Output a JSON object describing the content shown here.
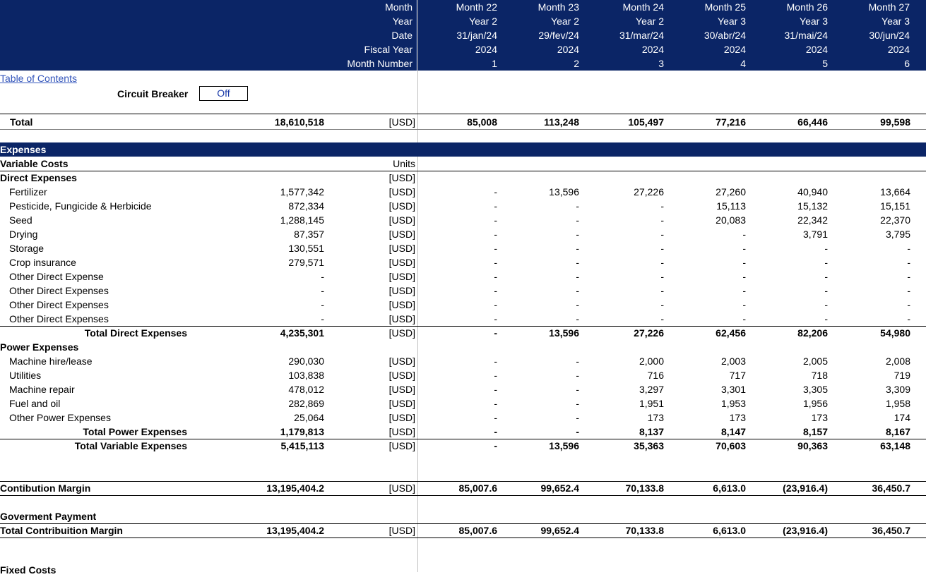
{
  "header": {
    "labels": [
      "Month",
      "Year",
      "Date",
      "Fiscal Year",
      "Month Number"
    ],
    "months": [
      {
        "month": "Month 22",
        "year": "Year 2",
        "date": "31/jan/24",
        "fiscal": "2024",
        "num": "1"
      },
      {
        "month": "Month 23",
        "year": "Year 2",
        "date": "29/fev/24",
        "fiscal": "2024",
        "num": "2"
      },
      {
        "month": "Month 24",
        "year": "Year 2",
        "date": "31/mar/24",
        "fiscal": "2024",
        "num": "3"
      },
      {
        "month": "Month 25",
        "year": "Year 3",
        "date": "30/abr/24",
        "fiscal": "2024",
        "num": "4"
      },
      {
        "month": "Month 26",
        "year": "Year 3",
        "date": "31/mai/24",
        "fiscal": "2024",
        "num": "5"
      },
      {
        "month": "Month 27",
        "year": "Year 3",
        "date": "30/jun/24",
        "fiscal": "2024",
        "num": "6"
      }
    ]
  },
  "toc_link": "Table of Contents",
  "circuit_breaker": {
    "label": "Circuit Breaker",
    "value": "Off"
  },
  "total_row": {
    "label": "Total",
    "total": "18,610,518",
    "unit": "[USD]",
    "values": [
      "85,008",
      "113,248",
      "105,497",
      "77,216",
      "66,446",
      "99,598"
    ]
  },
  "section_title": "Expenses",
  "variable_costs": {
    "label": "Variable Costs",
    "units_header": "Units"
  },
  "direct_expenses": {
    "label": "Direct Expenses",
    "unit_row": "[USD]",
    "rows": [
      {
        "label": "Fertilizer",
        "total": "1,577,342",
        "unit": "[USD]",
        "values": [
          "-",
          "13,596",
          "27,226",
          "27,260",
          "40,940",
          "13,664"
        ]
      },
      {
        "label": "Pesticide, Fungicide & Herbicide",
        "total": "872,334",
        "unit": "[USD]",
        "values": [
          "-",
          "-",
          "-",
          "15,113",
          "15,132",
          "15,151"
        ]
      },
      {
        "label": "Seed",
        "total": "1,288,145",
        "unit": "[USD]",
        "values": [
          "-",
          "-",
          "-",
          "20,083",
          "22,342",
          "22,370"
        ]
      },
      {
        "label": "Drying",
        "total": "87,357",
        "unit": "[USD]",
        "values": [
          "-",
          "-",
          "-",
          "-",
          "3,791",
          "3,795"
        ]
      },
      {
        "label": "Storage",
        "total": "130,551",
        "unit": "[USD]",
        "values": [
          "-",
          "-",
          "-",
          "-",
          "-",
          "-"
        ]
      },
      {
        "label": "Crop insurance",
        "total": "279,571",
        "unit": "[USD]",
        "values": [
          "-",
          "-",
          "-",
          "-",
          "-",
          "-"
        ]
      },
      {
        "label": "Other Direct Expense",
        "total": "-",
        "unit": "[USD]",
        "values": [
          "-",
          "-",
          "-",
          "-",
          "-",
          "-"
        ]
      },
      {
        "label": "Other Direct Expenses",
        "total": "-",
        "unit": "[USD]",
        "values": [
          "-",
          "-",
          "-",
          "-",
          "-",
          "-"
        ]
      },
      {
        "label": "Other Direct Expenses",
        "total": "-",
        "unit": "[USD]",
        "values": [
          "-",
          "-",
          "-",
          "-",
          "-",
          "-"
        ]
      },
      {
        "label": "Other Direct Expenses",
        "total": "-",
        "unit": "[USD]",
        "values": [
          "-",
          "-",
          "-",
          "-",
          "-",
          "-"
        ]
      }
    ],
    "total": {
      "label": "Total Direct Expenses",
      "total": "4,235,301",
      "unit": "[USD]",
      "values": [
        "-",
        "13,596",
        "27,226",
        "62,456",
        "82,206",
        "54,980"
      ]
    }
  },
  "power_expenses": {
    "label": "Power Expenses",
    "rows": [
      {
        "label": "Machine hire/lease",
        "total": "290,030",
        "unit": "[USD]",
        "values": [
          "-",
          "-",
          "2,000",
          "2,003",
          "2,005",
          "2,008"
        ]
      },
      {
        "label": "Utilities",
        "total": "103,838",
        "unit": "[USD]",
        "values": [
          "-",
          "-",
          "716",
          "717",
          "718",
          "719"
        ]
      },
      {
        "label": "Machine repair",
        "total": "478,012",
        "unit": "[USD]",
        "values": [
          "-",
          "-",
          "3,297",
          "3,301",
          "3,305",
          "3,309"
        ]
      },
      {
        "label": "Fuel and oil",
        "total": "282,869",
        "unit": "[USD]",
        "values": [
          "-",
          "-",
          "1,951",
          "1,953",
          "1,956",
          "1,958"
        ]
      },
      {
        "label": "Other Power Expenses",
        "total": "25,064",
        "unit": "[USD]",
        "values": [
          "-",
          "-",
          "173",
          "173",
          "173",
          "174"
        ]
      }
    ],
    "total": {
      "label": "Total Power Expenses",
      "total": "1,179,813",
      "unit": "[USD]",
      "values": [
        "-",
        "-",
        "8,137",
        "8,147",
        "8,157",
        "8,167"
      ]
    }
  },
  "total_variable": {
    "label": "Total Variable Expenses",
    "total": "5,415,113",
    "unit": "[USD]",
    "values": [
      "-",
      "13,596",
      "35,363",
      "70,603",
      "90,363",
      "63,148"
    ]
  },
  "contribution_margin": {
    "label": "Contibution Margin",
    "total": "13,195,404.2",
    "unit": "[USD]",
    "values": [
      "85,007.6",
      "99,652.4",
      "70,133.8",
      "6,613.0",
      "(23,916.4)",
      "36,450.7"
    ]
  },
  "government_payment": {
    "label": "Goverment Payment"
  },
  "total_contribution": {
    "label": "Total Contribuition Margin",
    "total": "13,195,404.2",
    "unit": "[USD]",
    "values": [
      "85,007.6",
      "99,652.4",
      "70,133.8",
      "6,613.0",
      "(23,916.4)",
      "36,450.7"
    ]
  },
  "fixed_costs": {
    "label": "Fixed Costs"
  },
  "colors": {
    "header_bg": "#0b2566",
    "link": "#3355bb"
  }
}
